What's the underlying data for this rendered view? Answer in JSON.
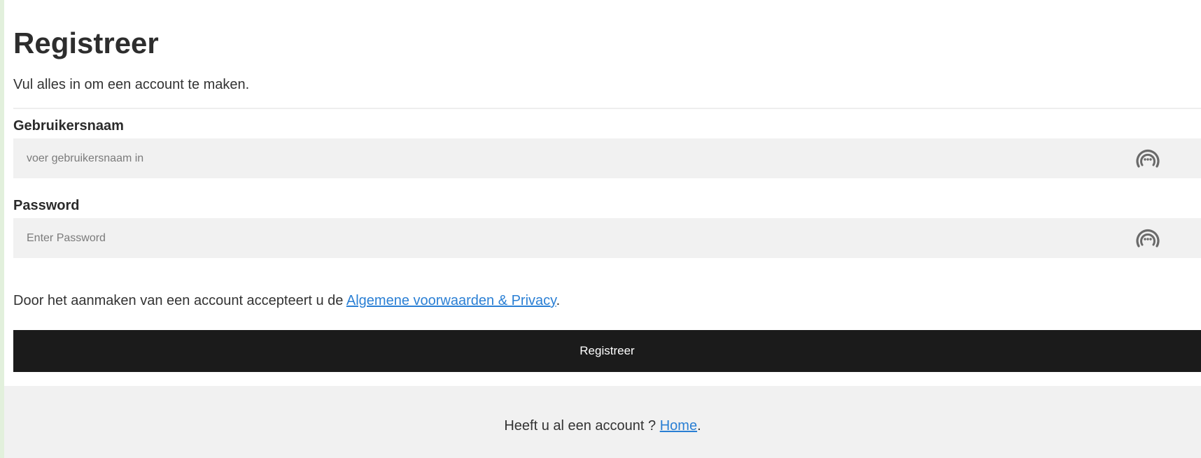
{
  "page": {
    "title": "Registreer",
    "subtitle": "Vul alles in om een account te maken."
  },
  "fields": {
    "username": {
      "label": "Gebruikersnaam",
      "placeholder": "voer gebruikersnaam in",
      "value": "",
      "icon": "password-manager-icon"
    },
    "password": {
      "label": "Password",
      "placeholder": "Enter Password",
      "value": "",
      "icon": "password-manager-icon"
    }
  },
  "terms": {
    "text": "Door het aanmaken van een account accepteert u de ",
    "link_label": "Algemene voorwaarden & Privacy",
    "suffix": "."
  },
  "register_button": {
    "label": "Registreer"
  },
  "footer": {
    "text": "Heeft u al een account ? ",
    "link_label": "Home",
    "suffix": "."
  },
  "colors": {
    "link": "#2a7fd4",
    "button_bg": "#1b1b1b",
    "input_bg": "#f1f1f1",
    "footer_bg": "#f1f1f1",
    "left_strip": "#e2f0dc"
  }
}
